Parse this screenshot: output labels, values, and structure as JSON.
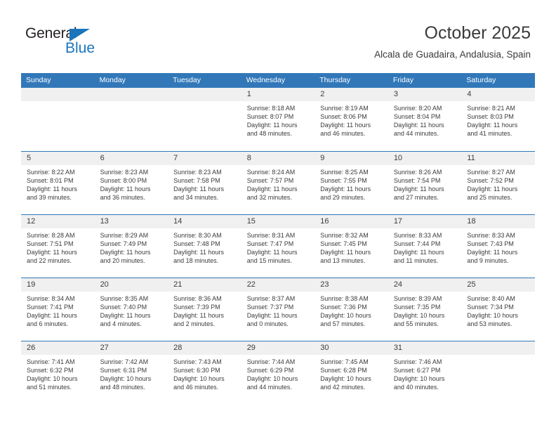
{
  "logo": {
    "word_one": "General",
    "word_two": "Blue",
    "triangle_color": "#1b75bb",
    "text_color": "#231f20"
  },
  "header": {
    "title": "October 2025",
    "subtitle": "Alcala de Guadaira, Andalusia, Spain"
  },
  "theme": {
    "header_blue": "#3278b9",
    "daynum_band": "#f0f0f0",
    "text": "#3b3b3b"
  },
  "calendar": {
    "weekday_headers": [
      "Sunday",
      "Monday",
      "Tuesday",
      "Wednesday",
      "Thursday",
      "Friday",
      "Saturday"
    ],
    "weeks": [
      [
        {
          "day": "",
          "empty": true
        },
        {
          "day": "",
          "empty": true
        },
        {
          "day": "",
          "empty": true
        },
        {
          "day": "1",
          "sunrise": "Sunrise: 8:18 AM",
          "sunset": "Sunset: 8:07 PM",
          "daylight_line1": "Daylight: 11 hours",
          "daylight_line2": "and 48 minutes."
        },
        {
          "day": "2",
          "sunrise": "Sunrise: 8:19 AM",
          "sunset": "Sunset: 8:06 PM",
          "daylight_line1": "Daylight: 11 hours",
          "daylight_line2": "and 46 minutes."
        },
        {
          "day": "3",
          "sunrise": "Sunrise: 8:20 AM",
          "sunset": "Sunset: 8:04 PM",
          "daylight_line1": "Daylight: 11 hours",
          "daylight_line2": "and 44 minutes."
        },
        {
          "day": "4",
          "sunrise": "Sunrise: 8:21 AM",
          "sunset": "Sunset: 8:03 PM",
          "daylight_line1": "Daylight: 11 hours",
          "daylight_line2": "and 41 minutes."
        }
      ],
      [
        {
          "day": "5",
          "sunrise": "Sunrise: 8:22 AM",
          "sunset": "Sunset: 8:01 PM",
          "daylight_line1": "Daylight: 11 hours",
          "daylight_line2": "and 39 minutes."
        },
        {
          "day": "6",
          "sunrise": "Sunrise: 8:23 AM",
          "sunset": "Sunset: 8:00 PM",
          "daylight_line1": "Daylight: 11 hours",
          "daylight_line2": "and 36 minutes."
        },
        {
          "day": "7",
          "sunrise": "Sunrise: 8:23 AM",
          "sunset": "Sunset: 7:58 PM",
          "daylight_line1": "Daylight: 11 hours",
          "daylight_line2": "and 34 minutes."
        },
        {
          "day": "8",
          "sunrise": "Sunrise: 8:24 AM",
          "sunset": "Sunset: 7:57 PM",
          "daylight_line1": "Daylight: 11 hours",
          "daylight_line2": "and 32 minutes."
        },
        {
          "day": "9",
          "sunrise": "Sunrise: 8:25 AM",
          "sunset": "Sunset: 7:55 PM",
          "daylight_line1": "Daylight: 11 hours",
          "daylight_line2": "and 29 minutes."
        },
        {
          "day": "10",
          "sunrise": "Sunrise: 8:26 AM",
          "sunset": "Sunset: 7:54 PM",
          "daylight_line1": "Daylight: 11 hours",
          "daylight_line2": "and 27 minutes."
        },
        {
          "day": "11",
          "sunrise": "Sunrise: 8:27 AM",
          "sunset": "Sunset: 7:52 PM",
          "daylight_line1": "Daylight: 11 hours",
          "daylight_line2": "and 25 minutes."
        }
      ],
      [
        {
          "day": "12",
          "sunrise": "Sunrise: 8:28 AM",
          "sunset": "Sunset: 7:51 PM",
          "daylight_line1": "Daylight: 11 hours",
          "daylight_line2": "and 22 minutes."
        },
        {
          "day": "13",
          "sunrise": "Sunrise: 8:29 AM",
          "sunset": "Sunset: 7:49 PM",
          "daylight_line1": "Daylight: 11 hours",
          "daylight_line2": "and 20 minutes."
        },
        {
          "day": "14",
          "sunrise": "Sunrise: 8:30 AM",
          "sunset": "Sunset: 7:48 PM",
          "daylight_line1": "Daylight: 11 hours",
          "daylight_line2": "and 18 minutes."
        },
        {
          "day": "15",
          "sunrise": "Sunrise: 8:31 AM",
          "sunset": "Sunset: 7:47 PM",
          "daylight_line1": "Daylight: 11 hours",
          "daylight_line2": "and 15 minutes."
        },
        {
          "day": "16",
          "sunrise": "Sunrise: 8:32 AM",
          "sunset": "Sunset: 7:45 PM",
          "daylight_line1": "Daylight: 11 hours",
          "daylight_line2": "and 13 minutes."
        },
        {
          "day": "17",
          "sunrise": "Sunrise: 8:33 AM",
          "sunset": "Sunset: 7:44 PM",
          "daylight_line1": "Daylight: 11 hours",
          "daylight_line2": "and 11 minutes."
        },
        {
          "day": "18",
          "sunrise": "Sunrise: 8:33 AM",
          "sunset": "Sunset: 7:43 PM",
          "daylight_line1": "Daylight: 11 hours",
          "daylight_line2": "and 9 minutes."
        }
      ],
      [
        {
          "day": "19",
          "sunrise": "Sunrise: 8:34 AM",
          "sunset": "Sunset: 7:41 PM",
          "daylight_line1": "Daylight: 11 hours",
          "daylight_line2": "and 6 minutes."
        },
        {
          "day": "20",
          "sunrise": "Sunrise: 8:35 AM",
          "sunset": "Sunset: 7:40 PM",
          "daylight_line1": "Daylight: 11 hours",
          "daylight_line2": "and 4 minutes."
        },
        {
          "day": "21",
          "sunrise": "Sunrise: 8:36 AM",
          "sunset": "Sunset: 7:39 PM",
          "daylight_line1": "Daylight: 11 hours",
          "daylight_line2": "and 2 minutes."
        },
        {
          "day": "22",
          "sunrise": "Sunrise: 8:37 AM",
          "sunset": "Sunset: 7:37 PM",
          "daylight_line1": "Daylight: 11 hours",
          "daylight_line2": "and 0 minutes."
        },
        {
          "day": "23",
          "sunrise": "Sunrise: 8:38 AM",
          "sunset": "Sunset: 7:36 PM",
          "daylight_line1": "Daylight: 10 hours",
          "daylight_line2": "and 57 minutes."
        },
        {
          "day": "24",
          "sunrise": "Sunrise: 8:39 AM",
          "sunset": "Sunset: 7:35 PM",
          "daylight_line1": "Daylight: 10 hours",
          "daylight_line2": "and 55 minutes."
        },
        {
          "day": "25",
          "sunrise": "Sunrise: 8:40 AM",
          "sunset": "Sunset: 7:34 PM",
          "daylight_line1": "Daylight: 10 hours",
          "daylight_line2": "and 53 minutes."
        }
      ],
      [
        {
          "day": "26",
          "sunrise": "Sunrise: 7:41 AM",
          "sunset": "Sunset: 6:32 PM",
          "daylight_line1": "Daylight: 10 hours",
          "daylight_line2": "and 51 minutes."
        },
        {
          "day": "27",
          "sunrise": "Sunrise: 7:42 AM",
          "sunset": "Sunset: 6:31 PM",
          "daylight_line1": "Daylight: 10 hours",
          "daylight_line2": "and 48 minutes."
        },
        {
          "day": "28",
          "sunrise": "Sunrise: 7:43 AM",
          "sunset": "Sunset: 6:30 PM",
          "daylight_line1": "Daylight: 10 hours",
          "daylight_line2": "and 46 minutes."
        },
        {
          "day": "29",
          "sunrise": "Sunrise: 7:44 AM",
          "sunset": "Sunset: 6:29 PM",
          "daylight_line1": "Daylight: 10 hours",
          "daylight_line2": "and 44 minutes."
        },
        {
          "day": "30",
          "sunrise": "Sunrise: 7:45 AM",
          "sunset": "Sunset: 6:28 PM",
          "daylight_line1": "Daylight: 10 hours",
          "daylight_line2": "and 42 minutes."
        },
        {
          "day": "31",
          "sunrise": "Sunrise: 7:46 AM",
          "sunset": "Sunset: 6:27 PM",
          "daylight_line1": "Daylight: 10 hours",
          "daylight_line2": "and 40 minutes."
        },
        {
          "day": "",
          "empty": true
        }
      ]
    ]
  }
}
